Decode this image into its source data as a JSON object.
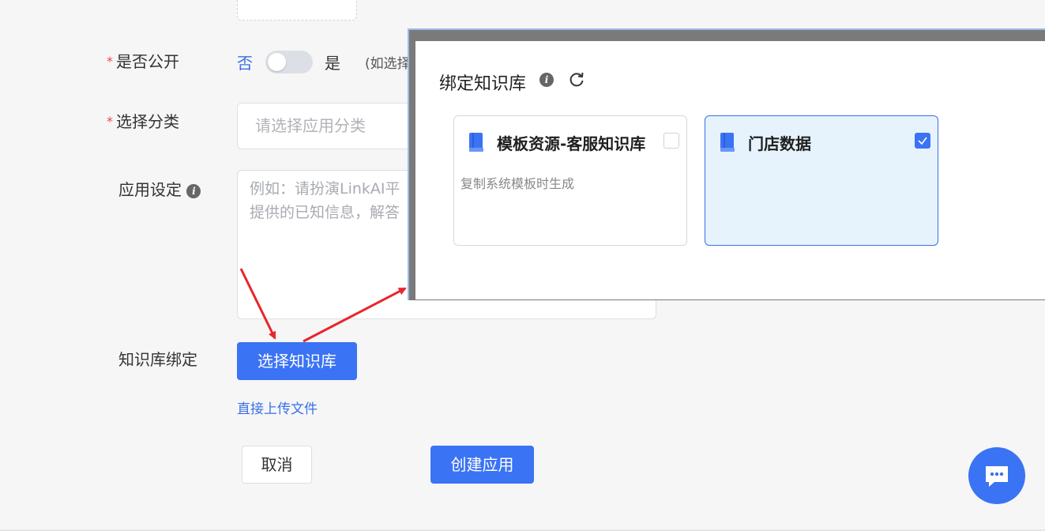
{
  "form": {
    "public_label": "是否公开",
    "public_no": "否",
    "public_yes": "是",
    "public_hint": "(如选择",
    "category_label": "选择分类",
    "category_placeholder": "请选择应用分类",
    "setting_label": "应用设定",
    "setting_placeholder_line1": "例如：请扮演LinkAI平",
    "setting_placeholder_line2": "提供的已知信息，解答",
    "kb_label": "知识库绑定",
    "select_kb_button": "选择知识库",
    "upload_link": "直接上传文件",
    "cancel_button": "取消",
    "create_button": "创建应用",
    "required_mark": "*"
  },
  "dialog": {
    "title": "绑定知识库",
    "cards": [
      {
        "name": "模板资源-客服知识库",
        "desc": "复制系统模板时生成",
        "checked": false
      },
      {
        "name": "门店数据",
        "desc": "",
        "checked": true
      }
    ]
  },
  "icons": {
    "info": "info-icon",
    "refresh": "refresh-icon",
    "book": "book-icon",
    "chat": "chat-icon"
  },
  "colors": {
    "primary": "#3a73f3",
    "link": "#3a6fe8",
    "required": "#f04747",
    "selected_card_bg": "#e6f3fc",
    "arrow": "#e8262b"
  }
}
